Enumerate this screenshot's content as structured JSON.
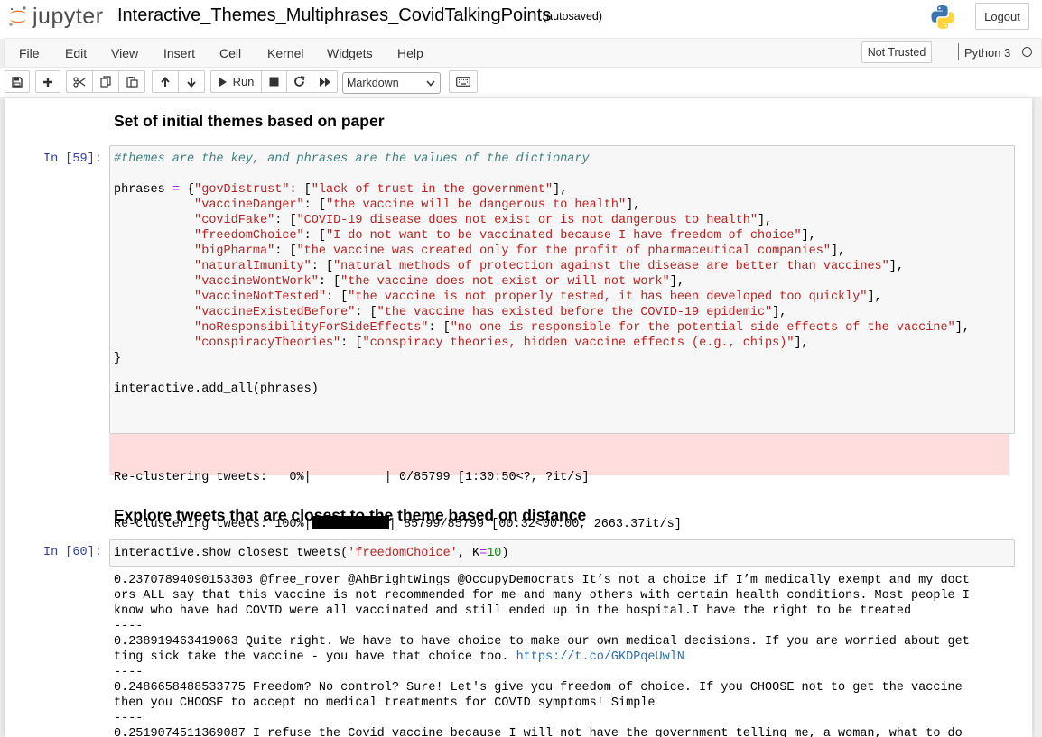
{
  "header": {
    "logo_text": "jupyter",
    "notebook_title": "Interactive_Themes_Multiphrases_CovidTalkingPoints",
    "autosave_status": "(autosaved)",
    "logout_label": "Logout"
  },
  "menu": {
    "items": [
      "File",
      "Edit",
      "View",
      "Insert",
      "Cell",
      "Kernel",
      "Widgets",
      "Help"
    ],
    "trust_status": "Not Trusted",
    "kernel_name": "Python 3"
  },
  "toolbar": {
    "run_label": "Run",
    "cell_type": "Markdown"
  },
  "cells": {
    "heading1": "Set of initial themes based on paper",
    "prompt1": "In [59]:",
    "heading2": "Explore tweets that are closest to the theme based on distance",
    "prompt2": "In [60]:",
    "code1": {
      "comment": "#themes are the key, and phrases are the values of the dictionary",
      "var": "phrases",
      "entries": [
        {
          "key": "\"govDistrust\"",
          "value": "\"lack of trust in the government\""
        },
        {
          "key": "\"vaccineDanger\"",
          "value": "\"the vaccine will be dangerous to health\""
        },
        {
          "key": "\"covidFake\"",
          "value": "\"COVID-19 disease does not exist or is not dangerous to health\""
        },
        {
          "key": "\"freedomChoice\"",
          "value": "\"I do not want to be vaccinated because I have freedom of choice\""
        },
        {
          "key": "\"bigPharma\"",
          "value": "\"the vaccine was created only for the profit of pharmaceutical companies\""
        },
        {
          "key": "\"naturalImunity\"",
          "value": "\"natural methods of protection against the disease are better than vaccines\""
        },
        {
          "key": "\"vaccineWontWork\"",
          "value": "\"the vaccine does not exist or will not work\""
        },
        {
          "key": "\"vaccineNotTested\"",
          "value": "\"the vaccine is not properly tested, it has been developed too quickly\""
        },
        {
          "key": "\"vaccineExistedBefore\"",
          "value": "\"the vaccine has existed before the COVID-19 epidemic\""
        },
        {
          "key": "\"noResponsibilityForSideEffects\"",
          "value": "\"no one is responsible for the potential side effects of the vaccine\""
        },
        {
          "key": "\"conspiracyTheories\"",
          "value": "\"conspiracy theories, hidden vaccine effects (e.g., chips)\""
        }
      ],
      "call": "interactive.add_all(phrases)"
    },
    "stderr": {
      "line1": "Re-clustering tweets:   0%|          | 0/85799 [1:30:50<?, ?it/s]",
      "line2_prefix": "Re-clustering tweets: 100%|",
      "line2_suffix": "| 85799/85799 [00:32<00:00, 2663.37it/s]"
    },
    "code2": {
      "func": "interactive.show_closest_tweets(",
      "arg1": "'freedomChoice'",
      "sep": ", ",
      "kw": "K",
      "eq": "=",
      "num": "10",
      "close": ")"
    },
    "output2": {
      "t1": "0.23707894090153303 @free_rover @AhBrightWings @OccupyDemocrats It’s not a choice if I’m medically exempt and my doct\nors ALL say that this vaccine is not recommended for me and many others with certain health conditions. Most people I\nknow who have had COVID were all vaccinated and still ended up in the hospital.I have the right to be treated",
      "sep": "----",
      "t2": "0.238919463419063 Quite right. We have to have choice to make our own medical decisions. If you are worried about get\nting sick take the vaccine - you have that choice too. ",
      "t2_link": "https://t.co/GKDPqeUwlN",
      "t3": "0.2486658488533775 Freedom? No control? Sure! Let's give you freedom of choice. If you CHOOSE not to get the vaccine\nthen you CHOOSE to accept no medical treatments for COVID symptoms! Simple",
      "t4": "0.2519074511369087 I refuse the Covid vaccine because I will not have the government telling me, a woman, what to do"
    }
  }
}
